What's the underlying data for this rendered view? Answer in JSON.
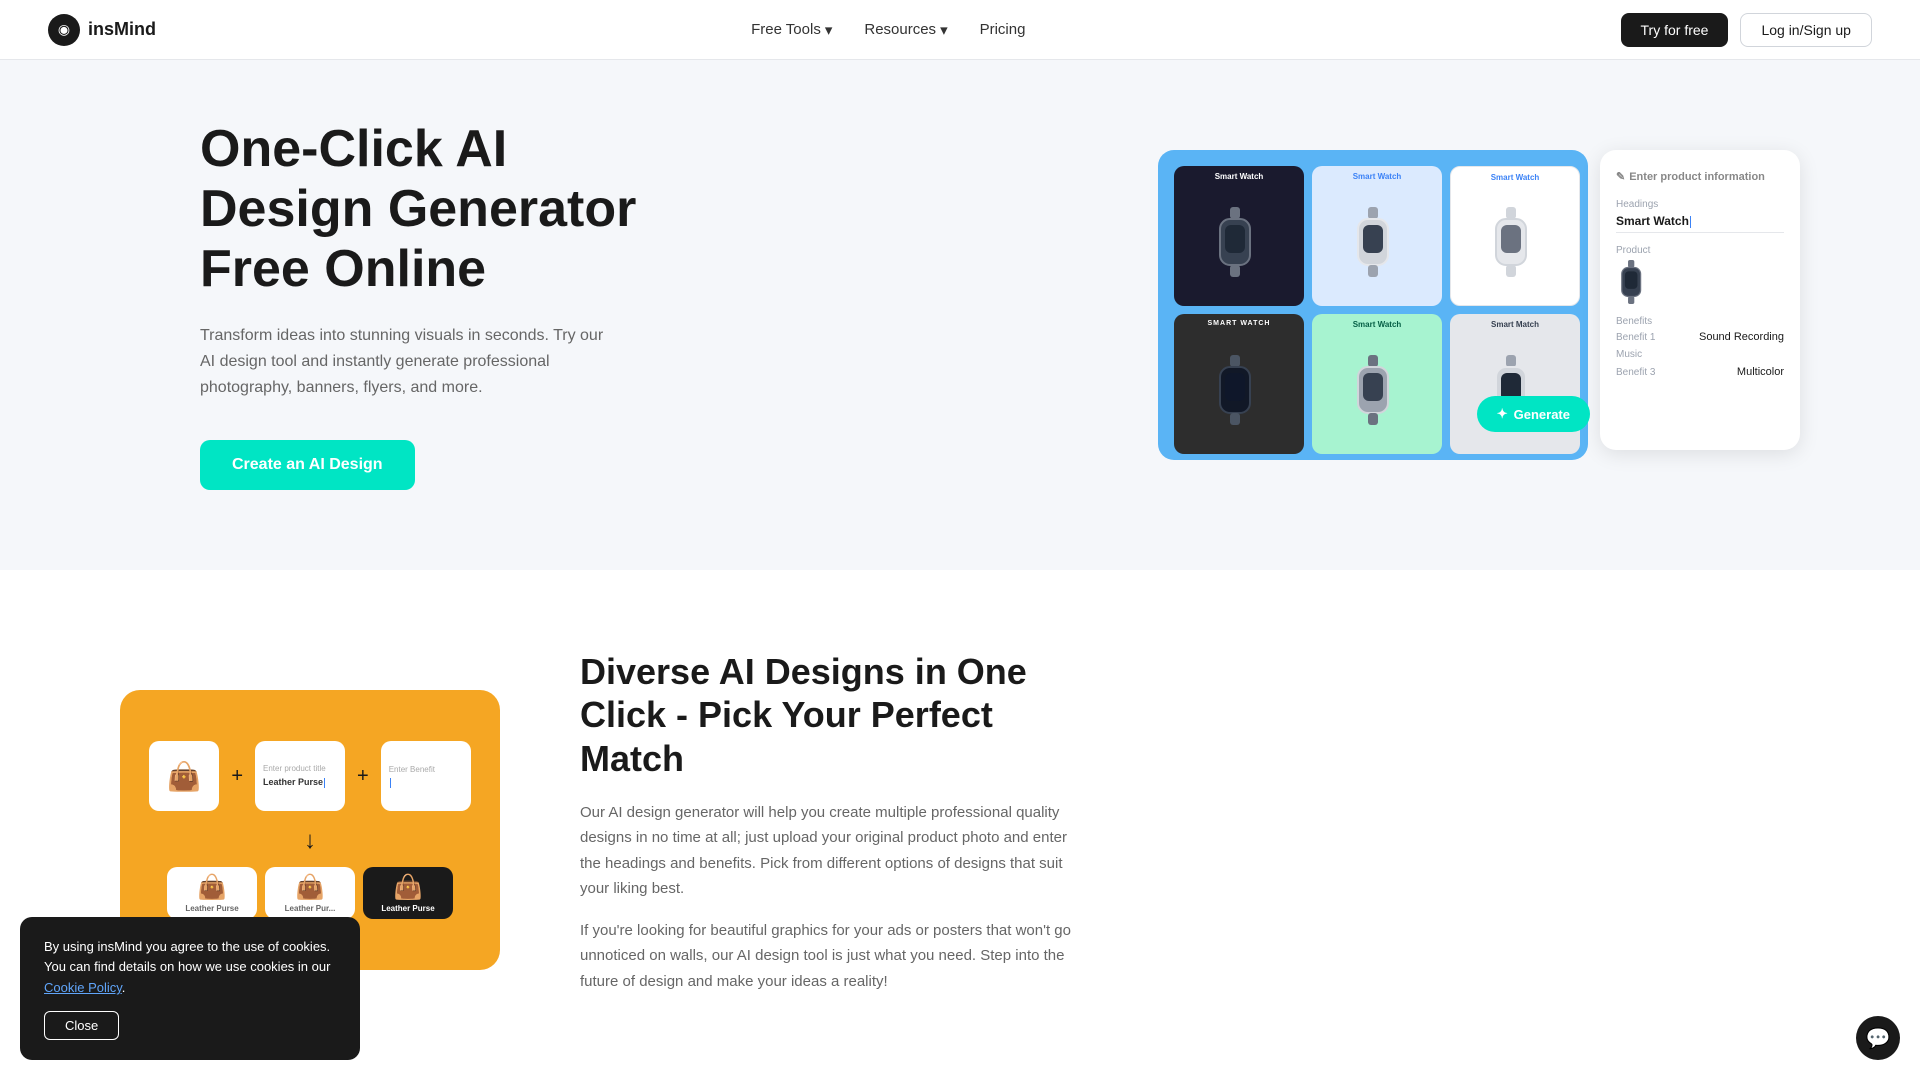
{
  "nav": {
    "logo_text": "insMind",
    "links": [
      {
        "label": "Free Tools",
        "has_dropdown": true
      },
      {
        "label": "Resources",
        "has_dropdown": true
      },
      {
        "label": "Pricing",
        "has_dropdown": false
      }
    ],
    "btn_try": "Try for free",
    "btn_login": "Log in/Sign up"
  },
  "hero": {
    "title": "One-Click AI Design Generator Free Online",
    "subtitle": "Transform ideas into stunning visuals in seconds. Try our AI design tool and instantly generate professional photography, banners, flyers, and more.",
    "cta": "Create an AI Design",
    "watch_cards": [
      {
        "label": "Smart Watch",
        "style": "dark",
        "label_color": "white"
      },
      {
        "label": "Smart Watch",
        "style": "light-blue",
        "label_color": "blue"
      },
      {
        "label": "Smart Watch",
        "style": "white",
        "label_color": "blue"
      },
      {
        "label": "SMART WATCH",
        "style": "dark-gray",
        "label_color": "white"
      },
      {
        "label": "Smart Watch",
        "style": "teal",
        "label_color": "dark"
      },
      {
        "label": "Smart Match",
        "style": "light-gray",
        "label_color": "dark"
      }
    ]
  },
  "panel": {
    "title": "Enter product information",
    "heading_label": "Headings",
    "heading_value": "Smart Watch",
    "product_label": "Product",
    "benefits_label": "Benefits",
    "benefit1_label": "Benefit 1",
    "benefit1_value": "Sound Recording",
    "benefit2_label": "Music",
    "benefit3_label": "Benefit 3",
    "benefit3_value": "Multicolor",
    "generate_btn": "Generate"
  },
  "section2": {
    "title": "Diverse AI Designs in One Click - Pick Your Perfect Match",
    "body1": "Our AI design generator will help you create multiple professional quality designs in no time at all; just upload your original product photo and enter the headings and benefits. Pick from different options of designs that suit your liking best.",
    "body2": "If you're looking for beautiful graphics for your ads or posters that won't go unnoticed on walls, our AI design tool is just what you need. Step into the future of design and make your ideas a reality!",
    "bag_labels": [
      "Leather Purse",
      "Leather Pur...",
      "Leather Purse"
    ]
  },
  "cookie": {
    "text": "By using insMind you agree to the use of cookies. You can find details on how we use cookies in our",
    "link_text": "Cookie Policy",
    "close_label": "Close"
  },
  "chat": {
    "icon": "💬"
  }
}
